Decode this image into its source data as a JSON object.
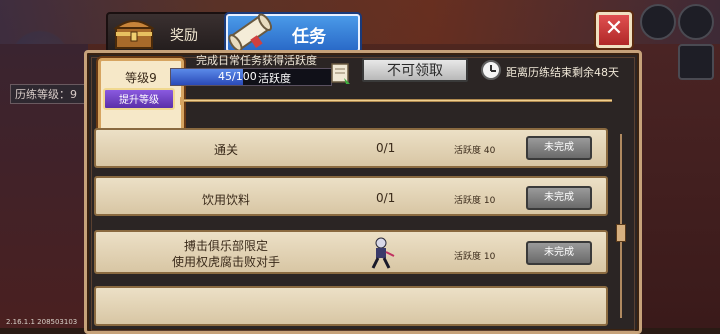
{
  "tabs": [
    {
      "label": "奖励",
      "active": false,
      "icon": "treasure-chest-icon"
    },
    {
      "label": "任务",
      "active": true,
      "icon": "scroll-icon"
    }
  ],
  "background": {
    "training_level_label": "历练等级：9"
  },
  "level": {
    "label": "等级9",
    "upgrade_label": "提升等级"
  },
  "daily": {
    "title": "完成日常任务获得活跃度",
    "progress_text": "45/100",
    "progress_fraction": 0.45,
    "unit_label": "活跃度"
  },
  "claim_button": "不可领取",
  "countdown": "距离历练结束剩余48天",
  "tasks": [
    {
      "name": "通关",
      "progress": "0/1",
      "activity": "活跃度 40",
      "status": "未完成"
    },
    {
      "name": "饮用饮料",
      "progress": "0/1",
      "activity": "活跃度 10",
      "status": "未完成"
    },
    {
      "name": "搏击俱乐部限定\n使用权虎腐击败对手",
      "progress": "",
      "activity": "活跃度 10",
      "status": "未完成"
    }
  ],
  "version": "2.16.1.1 208503103",
  "colors": {
    "accent_tab": "#3a7ad8",
    "panel_border": "#c6a27a",
    "row_bg": "#e4d6b8",
    "status_gray": "#8a8a8a",
    "close_red": "#d04040"
  }
}
